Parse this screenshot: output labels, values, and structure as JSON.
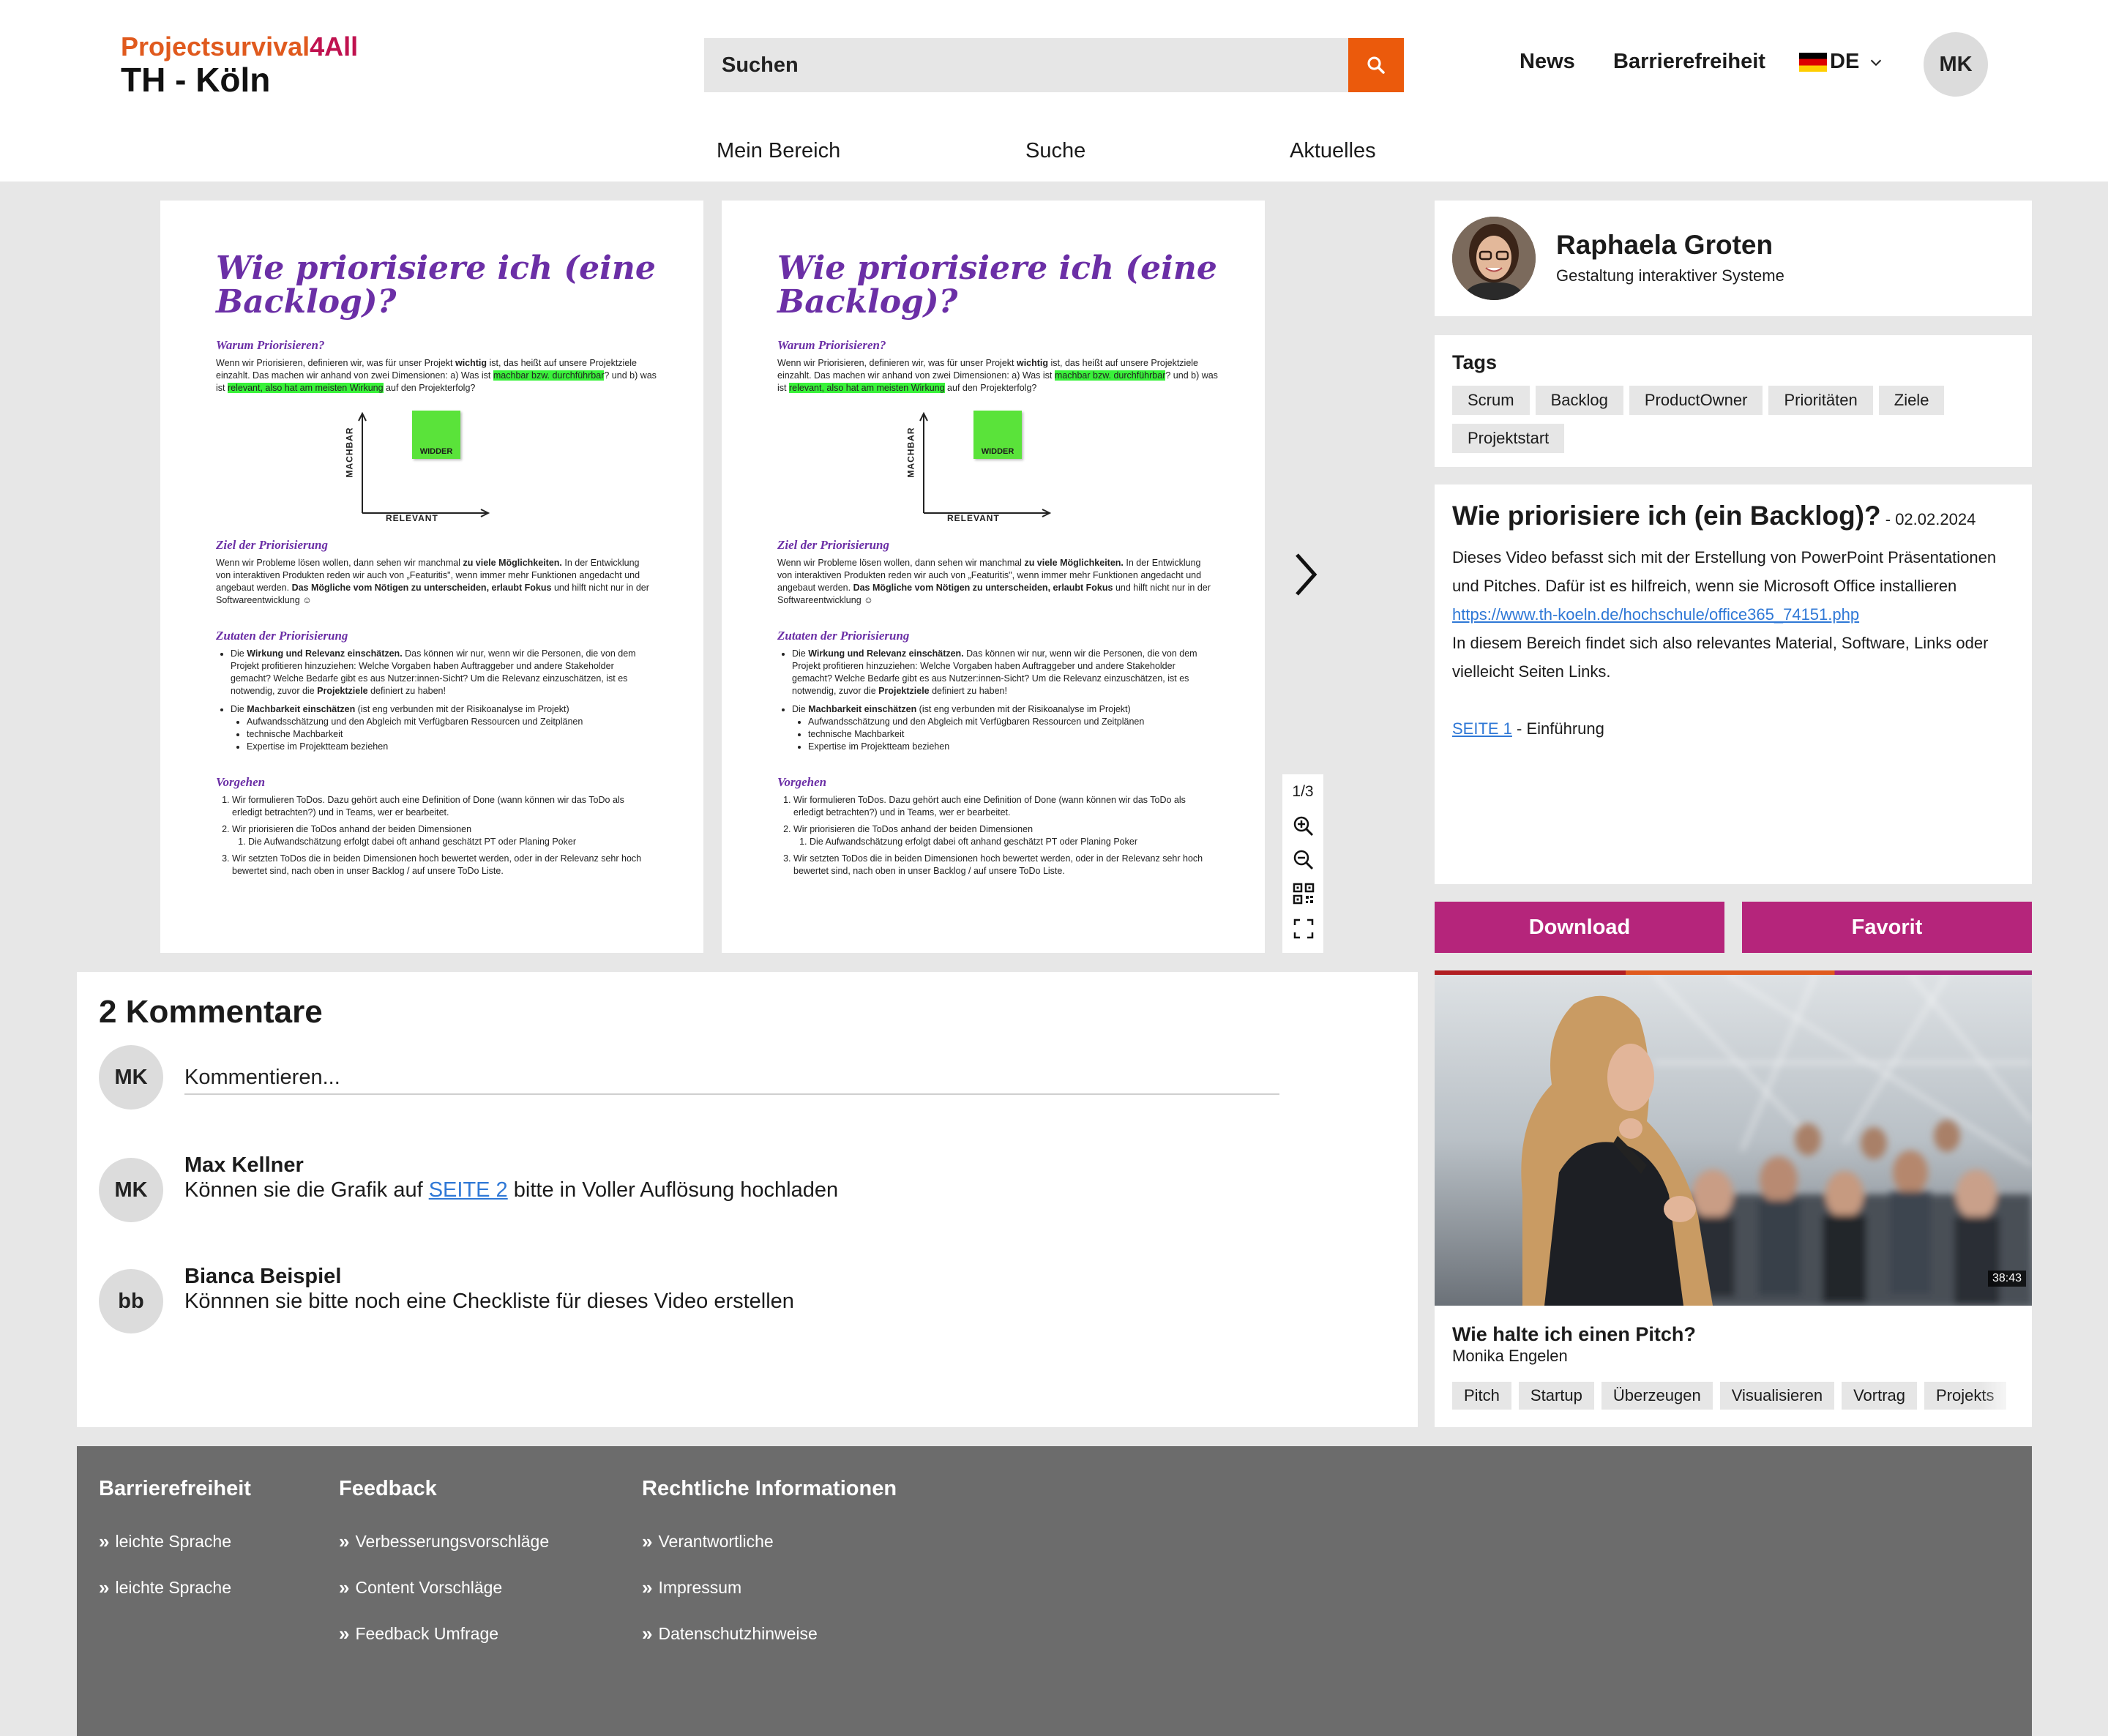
{
  "header": {
    "logo_top_1": "Projectsurvival",
    "logo_top_2": "4All",
    "logo_bottom": "TH - Köln",
    "search_placeholder": "Suchen",
    "nav_news": "News",
    "nav_accessibility": "Barrierefreiheit",
    "lang": "DE",
    "user_initials": "MK",
    "subnav": [
      "Mein Bereich",
      "Suche",
      "Aktuelles"
    ]
  },
  "document": {
    "title": "Wie priorisiere ich (eine Backlog)?",
    "h_why": "Warum Priorisieren?",
    "p_why_1": "Wenn wir Priorisieren, definieren wir, was für unser Projekt ",
    "p_why_bold": "wichtig",
    "p_why_2": " ist, das heißt auf unsere Projektziele einzahlt. Das machen wir anhand von zwei Dimensionen: a) Was ist ",
    "p_why_hl1": "machbar bzw. durchführbar",
    "p_why_3": "? und b) was ist ",
    "p_why_hl2": "relevant, also hat am meisten Wirkung",
    "p_why_4": " auf den Projekterfolg?",
    "axis_y": "MACHBAR",
    "axis_x": "RELEVANT",
    "sticky": "WIDDER",
    "h_goal": "Ziel der Priorisierung",
    "p_goal_1": "Wenn wir Probleme lösen wollen, dann sehen wir manchmal ",
    "p_goal_b1": "zu viele Möglichkeiten.",
    "p_goal_2": " In der Entwicklung von interaktiven Produkten reden wir auch von „Featuritis\", wenn immer mehr Funktionen angedacht und angebaut werden. ",
    "p_goal_b2": "Das Mögliche vom Nötigen zu unterscheiden, erlaubt Fokus",
    "p_goal_3": " und hilft nicht nur in der Softwareentwicklung ☺",
    "h_ingredients": "Zutaten der Priorisierung",
    "ing_1a": "Die ",
    "ing_1b": "Wirkung und Relevanz einschätzen.",
    "ing_1c": " Das können wir nur, wenn wir die Personen, die von dem Projekt profitieren hinzuziehen: Welche Vorgaben haben Auftraggeber und andere Stakeholder gemacht? Welche Bedarfe gibt es aus Nutzer:innen-Sicht? Um die Relevanz einzuschätzen, ist es notwendig, zuvor die ",
    "ing_1d": "Projektziele",
    "ing_1e": " definiert zu haben!",
    "ing_2a": "Die ",
    "ing_2b": "Machbarkeit einschätzen",
    "ing_2c": " (ist eng verbunden mit der Risikoanalyse im Projekt)",
    "ing_sub": [
      "Aufwandsschätzung und  den Abgleich mit Verfügbaren Ressourcen und Zeitplänen",
      "technische Machbarkeit",
      "Expertise im Projektteam beziehen"
    ],
    "h_procedure": "Vorgehen",
    "proc_1": "Wir formulieren ToDos. Dazu gehört auch eine Definition of Done (wann können wir das ToDo als erledigt betrachten?) und in Teams, wer er bearbeitet.",
    "proc_2": "Wir priorisieren die ToDos anhand der beiden Dimensionen",
    "proc_2_1": "Die Aufwandschätzung erfolgt dabei oft anhand geschätzt PT oder Planing Poker",
    "proc_3": "Wir setzten ToDos die in beiden Dimensionen hoch bewertet werden, oder in der Relevanz sehr hoch bewertet sind, nach oben in unser Backlog / auf unsere ToDo Liste.",
    "page_counter": "1/3"
  },
  "author": {
    "name": "Raphaela Groten",
    "role": "Gestaltung interaktiver Systeme"
  },
  "tags": {
    "title": "Tags",
    "items": [
      "Scrum",
      "Backlog",
      "ProductOwner",
      "Prioritäten",
      "Ziele",
      "Projektstart"
    ]
  },
  "description": {
    "title": "Wie priorisiere ich (ein Backlog)?",
    "date": " - 02.02.2024",
    "text_1": "Dieses Video befasst sich mit der Erstellung von PowerPoint Präsentationen und Pitches. Dafür ist es hilfreich, wenn sie Microsoft Office installieren",
    "link": "https://www.th-koeln.de/hochschule/office365_74151.php",
    "text_2": "In diesem Bereich findet sich also relevantes Material, Software, Links oder vielleicht Seiten Links.",
    "page_link": "SEITE 1",
    "page_link_suffix": " - Einführung"
  },
  "actions": {
    "download": "Download",
    "favorite": "Favorit"
  },
  "video": {
    "duration": "38:43",
    "title": "Wie halte ich einen Pitch?",
    "author": "Monika Engelen",
    "tags": [
      "Pitch",
      "Startup",
      "Überzeugen",
      "Visualisieren",
      "Vortrag",
      "Projekts"
    ]
  },
  "comments": {
    "title": "2 Kommentare",
    "input_avatar": "MK",
    "input_placeholder": "Kommentieren...",
    "items": [
      {
        "avatar": "MK",
        "name": "Max Kellner",
        "text_1": "Können sie die Grafik auf ",
        "link": "SEITE 2",
        "text_2": " bitte in Voller Auflösung hochladen"
      },
      {
        "avatar": "bb",
        "name": "Bianca Beispiel",
        "text_1": "Könnnen sie bitte noch eine Checkliste für dieses Video erstellen"
      }
    ]
  },
  "footer": {
    "col1_title": "Barrierefreiheit",
    "col1_links": [
      "leichte Sprache",
      "leichte Sprache"
    ],
    "col2_title": "Feedback",
    "col2_links": [
      "Verbesserungsvorschläge",
      "Content Vorschläge",
      "Feedback Umfrage"
    ],
    "col3_title": "Rechtliche Informationen",
    "col3_links": [
      "Verantwortliche",
      "Impressum",
      "Datenschutzhinweise"
    ]
  },
  "colors": {
    "accent_orange": "#eb5a0c",
    "button_magenta": "#b5257b",
    "doc_purple": "#6b2fa6",
    "highlight_green": "#39f23a",
    "footer_gray": "#6c6c6c",
    "link_blue": "#2f78d6"
  }
}
